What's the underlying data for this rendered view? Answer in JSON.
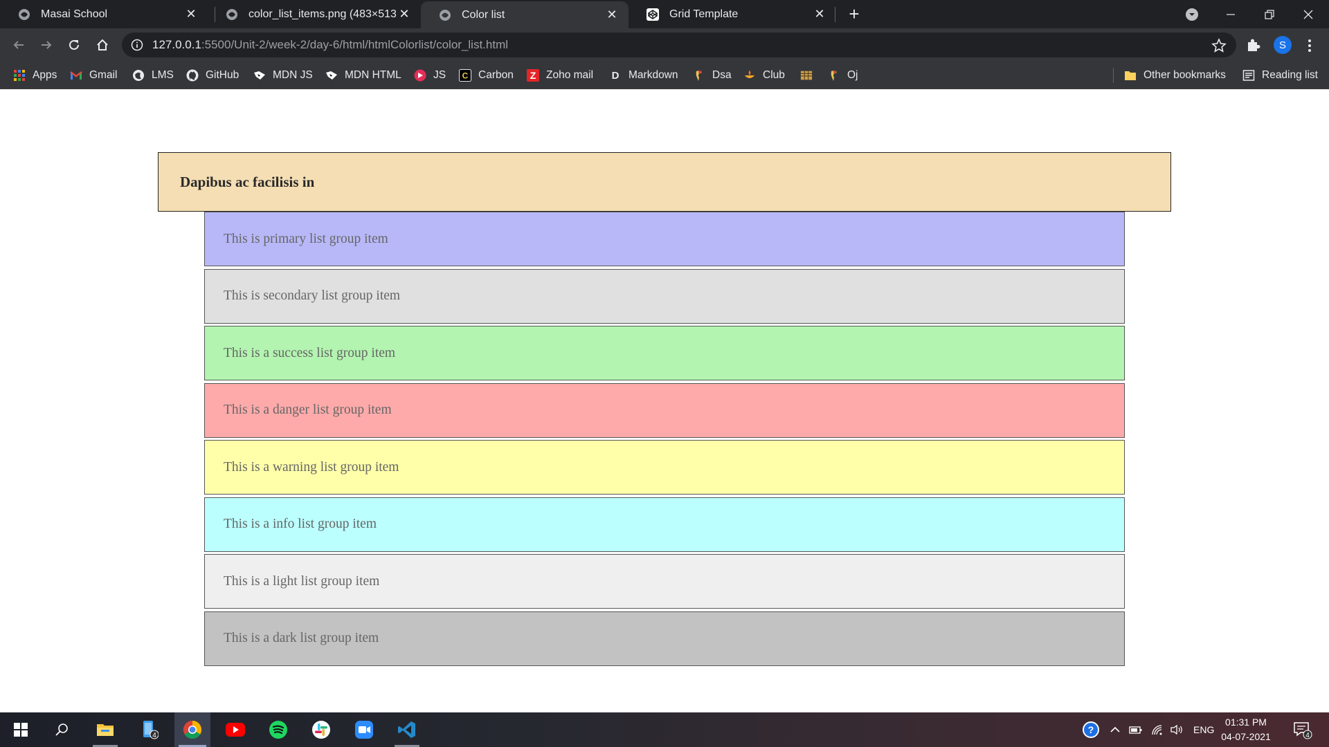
{
  "browser": {
    "tabs": [
      {
        "title": "Masai School",
        "icon": "globe-icon"
      },
      {
        "title": "color_list_items.png (483×513)",
        "icon": "globe-icon"
      },
      {
        "title": "Color list",
        "icon": "globe-icon",
        "active": true
      },
      {
        "title": "Grid Template",
        "icon": "codepen-icon"
      }
    ],
    "url_host": "127.0.0.1",
    "url_path": ":5500/Unit-2/week-2/day-6/html/htmlColorlist/color_list.html",
    "profile_initial": "S"
  },
  "bookmarks": {
    "items": [
      {
        "label": "Apps",
        "icon": "apps-grid-icon"
      },
      {
        "label": "Gmail",
        "icon": "gmail-icon"
      },
      {
        "label": "LMS",
        "icon": "globe-icon"
      },
      {
        "label": "GitHub",
        "icon": "github-icon"
      },
      {
        "label": "MDN JS",
        "icon": "mdn-icon"
      },
      {
        "label": "MDN HTML",
        "icon": "mdn-icon"
      },
      {
        "label": "JS",
        "icon": "js-icon"
      },
      {
        "label": "Carbon",
        "icon": "carbon-icon"
      },
      {
        "label": "Zoho mail",
        "icon": "zoho-icon"
      },
      {
        "label": "Markdown",
        "icon": "markdown-icon"
      },
      {
        "label": "Dsa",
        "icon": "dsa-icon"
      },
      {
        "label": "Club",
        "icon": "club-icon"
      },
      {
        "label": "",
        "icon": "bookmark-grid-icon"
      },
      {
        "label": "Oj",
        "icon": "oj-icon"
      }
    ],
    "other_bookmarks": "Other bookmarks",
    "reading_list": "Reading list"
  },
  "page": {
    "header": "Dapibus ac facilisis in",
    "list_items": [
      {
        "text": "This is primary list group item",
        "color": "#b8b8f8"
      },
      {
        "text": "This is secondary list group item",
        "color": "#e0e0e0"
      },
      {
        "text": "This is a success list group item",
        "color": "#b3f4b0"
      },
      {
        "text": "This is a danger list group item",
        "color": "#ffaaaa"
      },
      {
        "text": "This is a warning list group item",
        "color": "#ffffaa"
      },
      {
        "text": "This is a info list group item",
        "color": "#bcffff"
      },
      {
        "text": "This is a light list group item",
        "color": "#efefef"
      },
      {
        "text": "This is a dark list group item",
        "color": "#c2c2c2"
      }
    ],
    "header_color": "#f5deb3"
  },
  "taskbar": {
    "apps": [
      "windows-start-icon",
      "search-icon",
      "file-explorer-icon",
      "phone-icon",
      "chrome-icon",
      "youtube-icon",
      "spotify-icon",
      "slack-icon",
      "zoom-icon",
      "vscode-icon"
    ],
    "phone_badge": "4",
    "language": "ENG",
    "time": "01:31 PM",
    "date": "04-07-2021",
    "notification_count": "4"
  }
}
